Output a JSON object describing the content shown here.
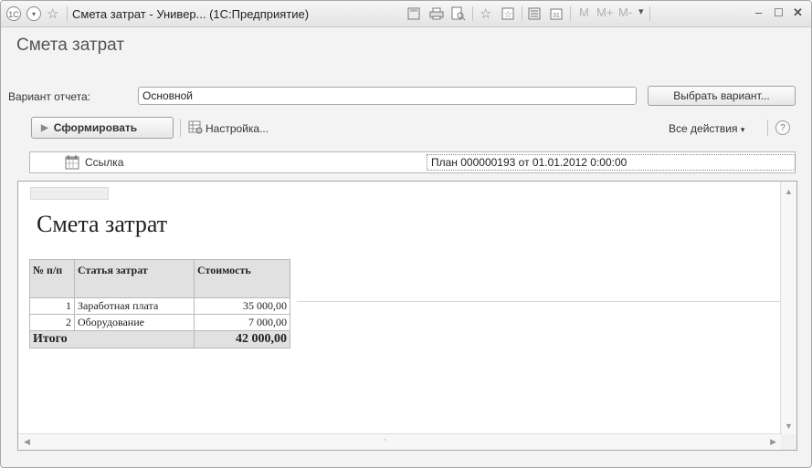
{
  "titlebar": {
    "app_logo": "1С",
    "title": "Смета затрат - Универ... (1С:Предприятие)",
    "m_label": "M",
    "mplus_label": "M+",
    "mminus_label": "M-",
    "icons": [
      "nav-menu-icon",
      "star-icon",
      "save-icon",
      "print-icon",
      "preview-icon",
      "favorites-icon",
      "add-favorite-icon",
      "calculator-icon",
      "calendar-icon",
      "minimize-icon",
      "maximize-icon",
      "close-icon"
    ]
  },
  "form": {
    "title": "Смета затрат",
    "variant_label": "Вариант отчета:",
    "variant_value": "Основной",
    "choose_variant_button": "Выбрать вариант...",
    "generate_button": "Сформировать",
    "settings_link": "Настройка...",
    "all_actions_menu": "Все действия",
    "help_label": "?"
  },
  "settings_row": {
    "field_label": "Ссылка",
    "field_value": "План 000000193 от 01.01.2012 0:00:00"
  },
  "report": {
    "title": "Смета затрат",
    "columns": [
      "№ п/п",
      "Статья затрат",
      "Стоимость"
    ],
    "rows": [
      {
        "num": "1",
        "item": "Заработная плата",
        "cost": "35 000,00"
      },
      {
        "num": "2",
        "item": "Оборудование",
        "cost": "7 000,00"
      }
    ],
    "total_label": "Итого",
    "total_value": "42 000,00"
  }
}
